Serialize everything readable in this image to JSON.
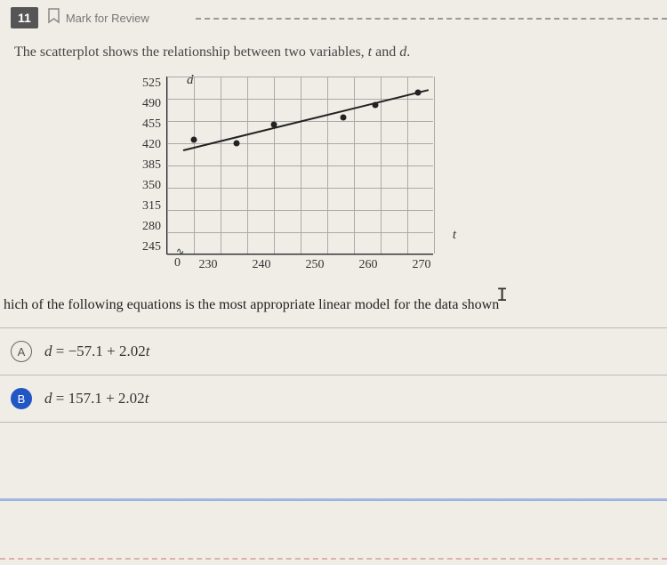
{
  "header": {
    "question_number": "11",
    "mark_label": "Mark for Review"
  },
  "question": {
    "prefix": "The scatterplot shows the relationship between two variables, ",
    "var1": "t",
    "mid": " and ",
    "var2": "d",
    "suffix": "."
  },
  "chart_data": {
    "type": "scatter",
    "title": "",
    "xlabel": "t",
    "ylabel": "d",
    "xlim": [
      225,
      275
    ],
    "ylim": [
      245,
      525
    ],
    "x_ticks": [
      "230",
      "240",
      "250",
      "260",
      "270"
    ],
    "y_ticks": [
      "525",
      "490",
      "455",
      "420",
      "385",
      "350",
      "315",
      "280",
      "245"
    ],
    "origin_label": "0",
    "points": [
      {
        "t": 230,
        "d": 425
      },
      {
        "t": 238,
        "d": 420
      },
      {
        "t": 245,
        "d": 450
      },
      {
        "t": 258,
        "d": 460
      },
      {
        "t": 264,
        "d": 480
      },
      {
        "t": 272,
        "d": 500
      }
    ],
    "trend": {
      "t1": 228,
      "d1": 410,
      "t2": 274,
      "d2": 505
    }
  },
  "sub_question": "hich of the following equations is the most appropriate linear model for the data shown",
  "answers": [
    {
      "letter": "A",
      "var": "d",
      "eq": " = −57.1 + 2.02",
      "var2": "t",
      "selected": false
    },
    {
      "letter": "B",
      "var": "d",
      "eq": " = 157.1 + 2.02",
      "var2": "t",
      "selected": true
    }
  ]
}
